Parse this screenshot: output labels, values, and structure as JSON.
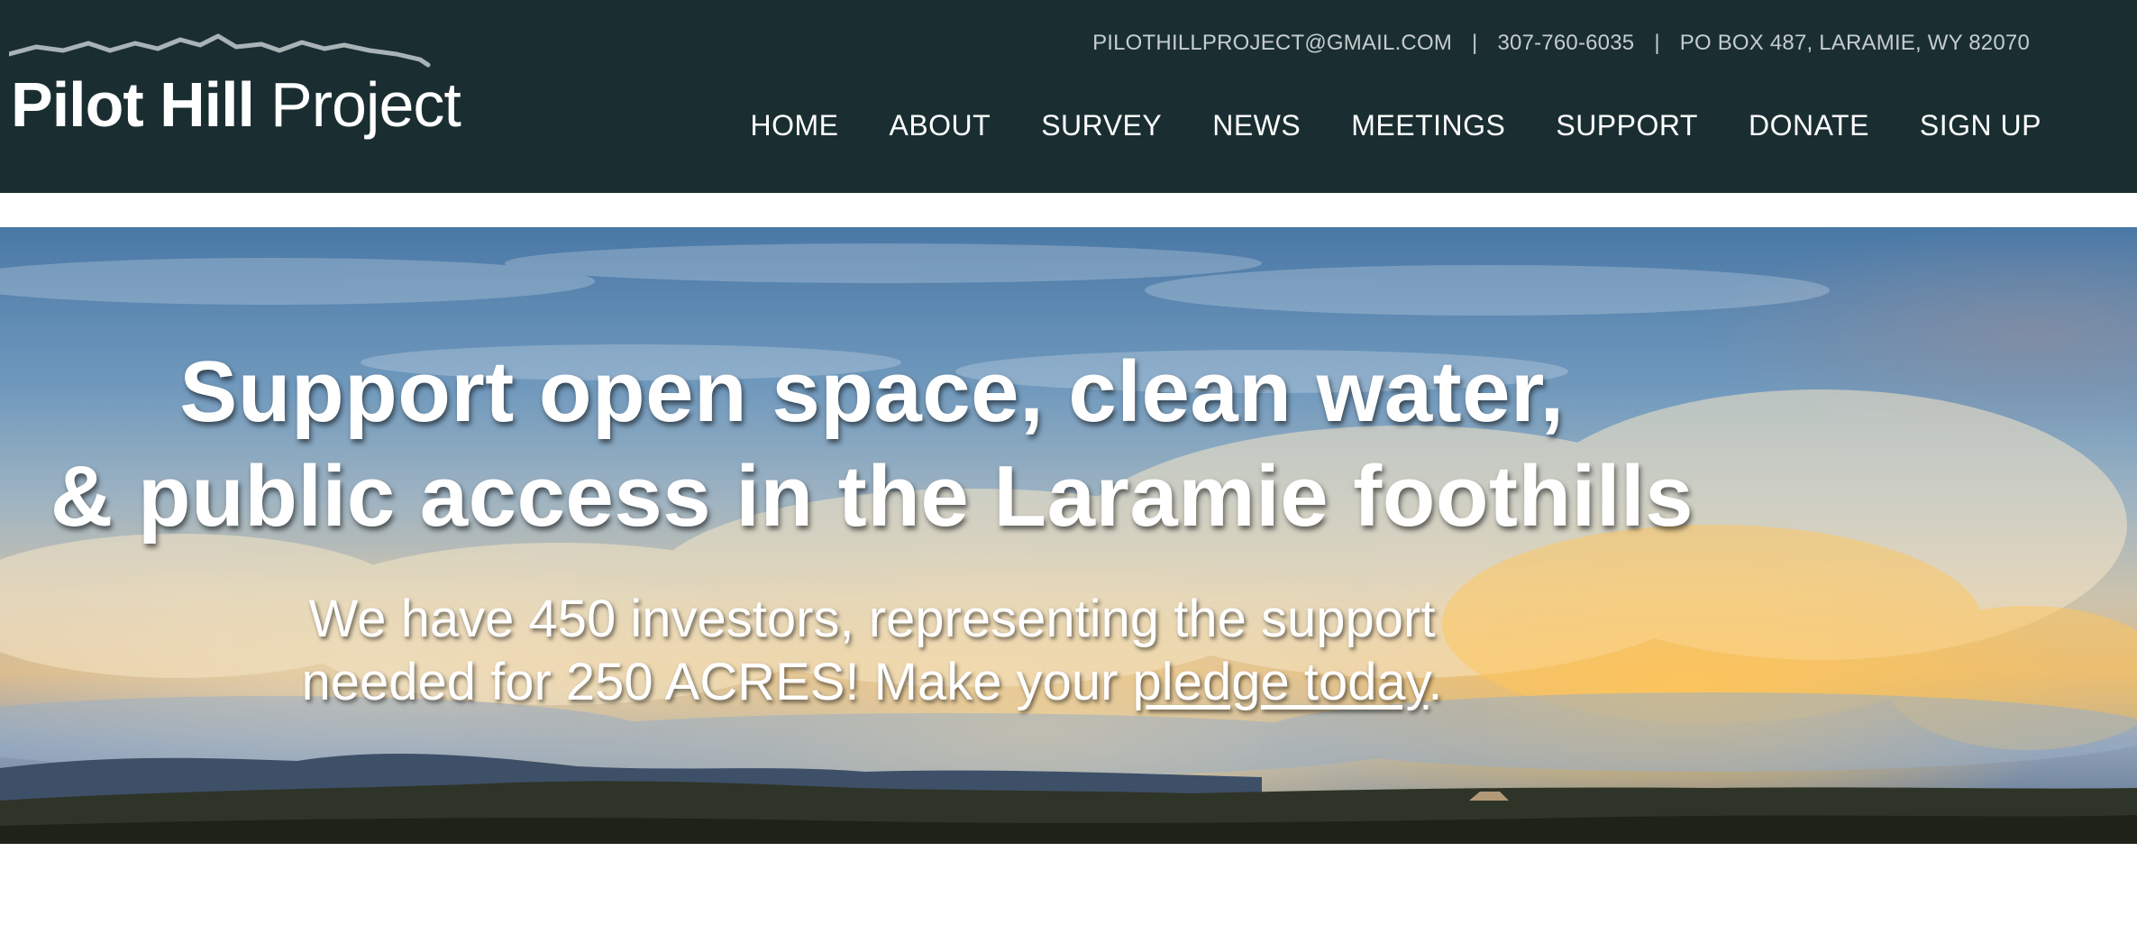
{
  "site": {
    "logo": {
      "bold": "Pilot Hill",
      "light": "Project",
      "icon": "mountain-range-icon"
    },
    "contact": {
      "email": "PILOTHILLPROJECT@GMAIL.COM",
      "separator": "|",
      "phone": "307-760-6035",
      "address": "PO BOX 487, LARAMIE, WY 82070"
    },
    "nav": [
      {
        "label": "HOME"
      },
      {
        "label": "ABOUT"
      },
      {
        "label": "SURVEY"
      },
      {
        "label": "NEWS"
      },
      {
        "label": "MEETINGS"
      },
      {
        "label": "SUPPORT"
      },
      {
        "label": "DONATE"
      },
      {
        "label": "SIGN UP"
      }
    ]
  },
  "hero": {
    "headline_line1": "Support open space, clean water,",
    "headline_line2": "& public access in the Laramie foothills",
    "sub_line1": "We have 450 investors, representing the support",
    "sub_line2_prefix": "needed for 250 ACRES! Make your",
    "sub_link": "pledge today",
    "sub_suffix": "."
  },
  "colors": {
    "header_bg": "#1a2e31",
    "nav_text": "#ffffff",
    "contact_text": "#c6ccce",
    "logo_mountains": "#a9b3b6"
  }
}
